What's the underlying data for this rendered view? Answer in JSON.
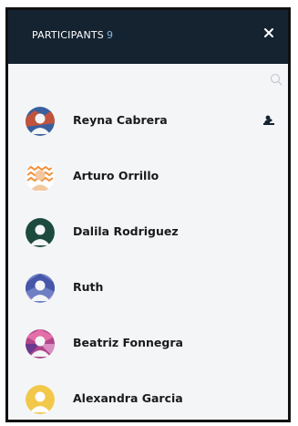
{
  "header": {
    "title": "PARTICIPANTS",
    "count": "9",
    "close_icon": "close-icon"
  },
  "search": {
    "icon": "search-icon"
  },
  "participants": [
    {
      "name": "Reyna Cabrera",
      "role_icon": "presenter-icon"
    },
    {
      "name": "Arturo Orrillo"
    },
    {
      "name": "Dalila Rodriguez"
    },
    {
      "name": "Ruth"
    },
    {
      "name": "Beatriz Fonnegra"
    },
    {
      "name": "Alexandra Garcia"
    }
  ],
  "colors": {
    "header_bg": "#152331",
    "count": "#7fb6e0",
    "list_bg": "#f4f5f7"
  }
}
